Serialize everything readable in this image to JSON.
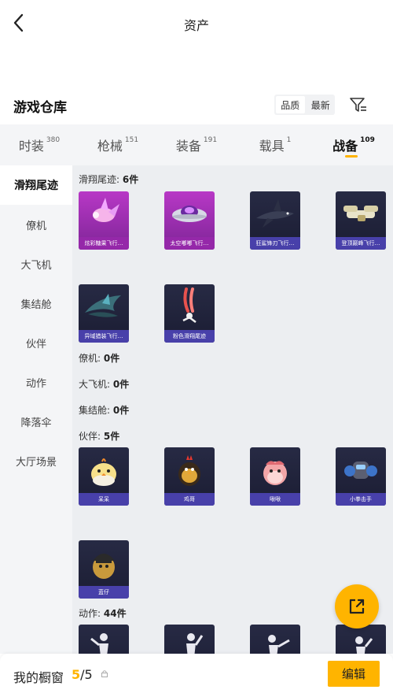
{
  "header": {
    "title": "资产"
  },
  "warehouse": {
    "title": "游戏仓库",
    "sort_options": [
      "品质",
      "最新"
    ]
  },
  "tabs": [
    {
      "label": "时装",
      "count": "380"
    },
    {
      "label": "枪械",
      "count": "151"
    },
    {
      "label": "装备",
      "count": "191"
    },
    {
      "label": "载具",
      "count": "1"
    },
    {
      "label": "战备",
      "count": "109"
    }
  ],
  "sidebar": {
    "items": [
      "滑翔尾迹",
      "僚机",
      "大飞机",
      "集结舱",
      "伙伴",
      "动作",
      "降落伞",
      "大厅场景"
    ]
  },
  "sections": {
    "glide": {
      "label": "滑翔尾迹:",
      "count": "6件",
      "items": [
        "炫彩糖果飞行…",
        "太空嘟嘟飞行…",
        "狂鲨锋刃飞行…",
        "登顶巅峰飞行…",
        "异域猎装飞行…",
        "粉色滑翔尾迹"
      ]
    },
    "wingman": {
      "label": "僚机:",
      "count": "0件"
    },
    "plane": {
      "label": "大飞机:",
      "count": "0件"
    },
    "pod": {
      "label": "集结舱:",
      "count": "0件"
    },
    "partner": {
      "label": "伙伴:",
      "count": "5件",
      "items": [
        "呆呆",
        "鸡哥",
        "啾啾",
        "小拳击手",
        "蓝仔"
      ]
    },
    "emote": {
      "label": "动作:",
      "count": "44件"
    }
  },
  "showcase": {
    "label": "我的橱窗",
    "current": "5",
    "total": "/5",
    "edit_label": "编辑"
  },
  "colors": {
    "accent": "#ffb400",
    "card_bg": "#1f2238",
    "card_purple": "#a02fb8"
  }
}
